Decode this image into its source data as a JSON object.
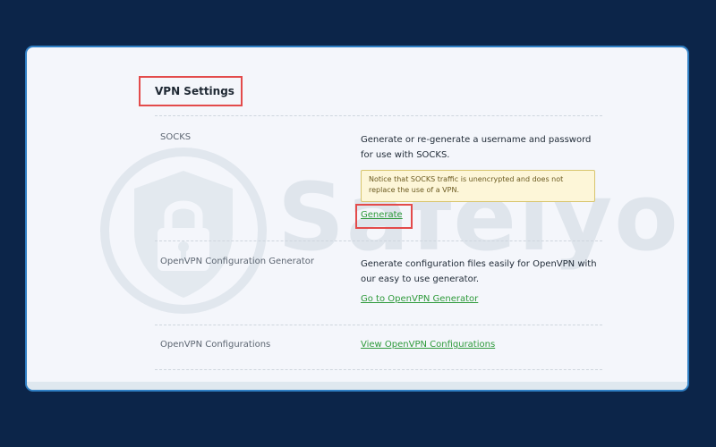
{
  "page": {
    "title": "VPN Settings"
  },
  "watermark": {
    "text": "Safelyo",
    "icon": "shield-lock-icon"
  },
  "rows": [
    {
      "label": "SOCKS",
      "description": "Generate or re-generate a username and password for use with SOCKS.",
      "notice": "Notice that SOCKS traffic is unencrypted and does not replace the use of a VPN.",
      "link": "Generate"
    },
    {
      "label": "OpenVPN Configuration Generator",
      "description": "Generate configuration files easily for OpenVPN with our easy to use generator.",
      "link": "Go to OpenVPN Generator"
    },
    {
      "label": "OpenVPN Configurations",
      "link": "View OpenVPN Configurations"
    }
  ],
  "colors": {
    "background": "#0c2549",
    "panel": "#f4f6fb",
    "panel_border": "#2f7fc4",
    "highlight": "#e34b4b",
    "link": "#2e9a3b",
    "notice_bg": "#fdf6d8"
  }
}
